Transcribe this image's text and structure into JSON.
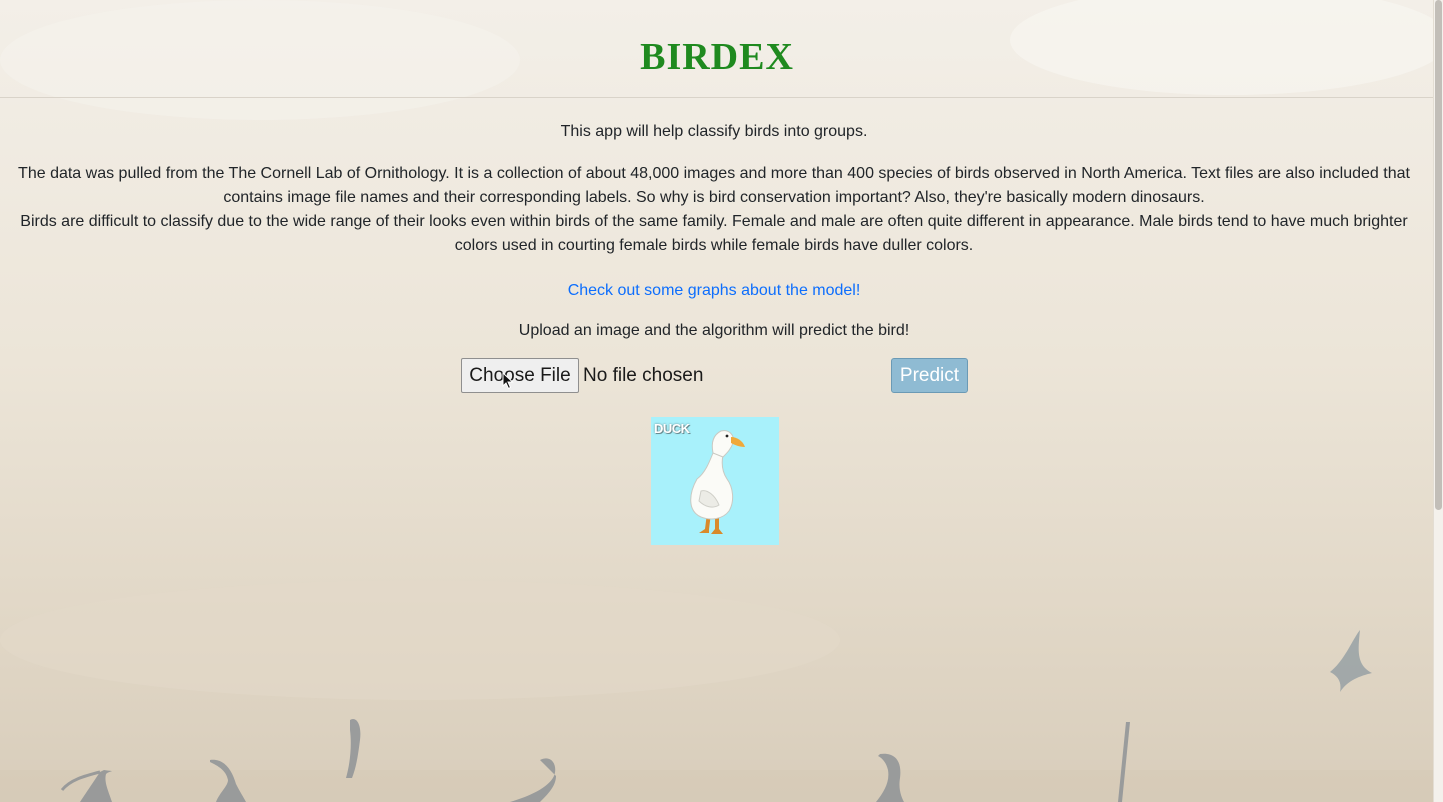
{
  "header": {
    "title": "BIRDEX"
  },
  "main": {
    "intro": "This app will help classify birds into groups.",
    "description_line1": "The data was pulled from the The Cornell Lab of Ornithology. It is a collection of about 48,000 images and more than 400 species of birds observed in North America. Text files are also included that contains image file names and their corresponding labels. So why is bird conservation important? Also, they're basically modern dinosaurs.",
    "description_line2": "Birds are difficult to classify due to the wide range of their looks even within birds of the same family. Female and male are often quite different in appearance. Male birds tend to have much brighter colors used in courting female birds while female birds have duller colors.",
    "graphs_link": "Check out some graphs about the model!",
    "upload_prompt": "Upload an image and the algorithm will predict the bird!"
  },
  "upload": {
    "choose_file_label": "Choose File",
    "no_file_text": "No file chosen",
    "predict_label": "Predict"
  },
  "preview": {
    "label": "DUCK"
  },
  "colors": {
    "title_green": "#1f8a1f",
    "link_blue": "#0d6efd",
    "predict_button": "#8fbbd3",
    "preview_background": "#a8f1fb"
  }
}
